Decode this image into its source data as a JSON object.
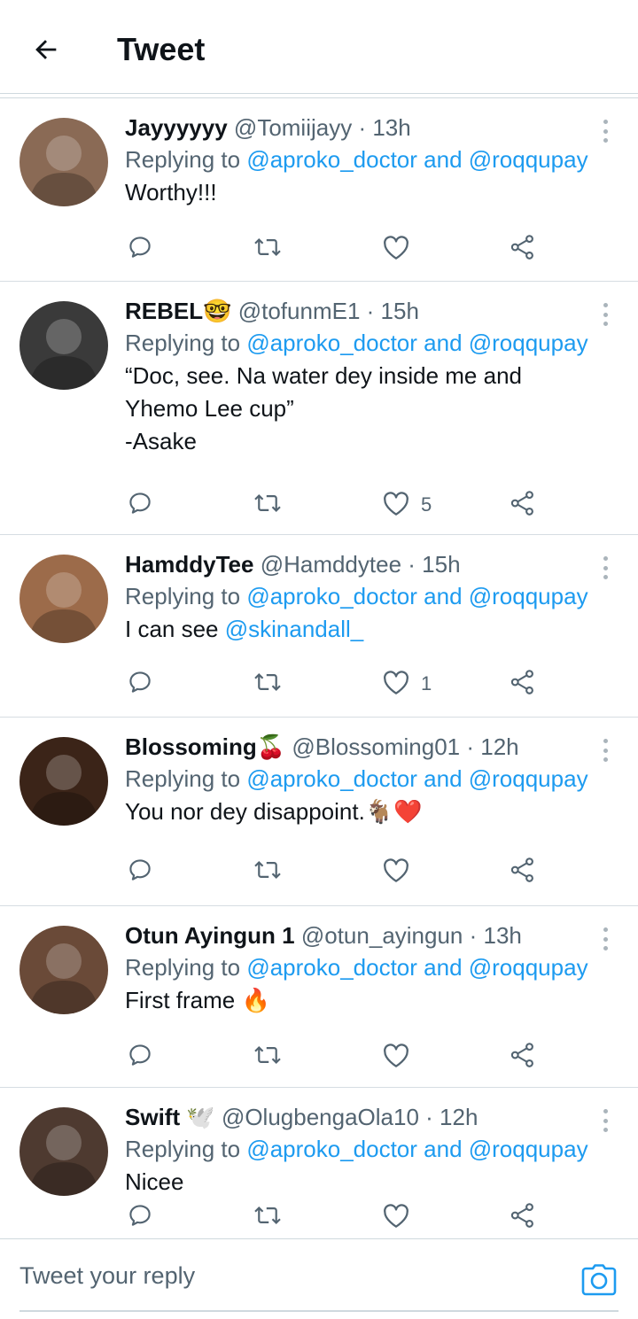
{
  "header": {
    "title": "Tweet"
  },
  "tweets": [
    {
      "name": "Jayyyyyy",
      "handle": "@Tomiijayy",
      "time": "13h",
      "replying_prefix": "Replying to",
      "replying_to": "@aproko_doctor and @roqqupay",
      "lines": [
        "Worthy!!!"
      ],
      "like_count": "",
      "avatar_bg": "#8a6a55"
    },
    {
      "name": "REBEL🤓",
      "handle": "@tofunmE1",
      "time": "15h",
      "replying_prefix": "Replying to",
      "replying_to": "@aproko_doctor and @roqqupay",
      "lines": [
        "“Doc, see. Na water dey inside me and",
        "Yhemo Lee cup”",
        "-Asake"
      ],
      "like_count": "5",
      "avatar_bg": "#3a3a3a"
    },
    {
      "name": "HamddyTee",
      "handle": "@Hamddytee",
      "time": "15h",
      "replying_prefix": "Replying to",
      "replying_to": "@aproko_doctor and @roqqupay",
      "lines": [
        "I can see"
      ],
      "mention": "@skinandall_",
      "like_count": "1",
      "avatar_bg": "#9c6b4a"
    },
    {
      "name": "Blossoming🍒",
      "handle": "@Blossoming01",
      "time": "12h",
      "replying_prefix": "Replying to",
      "replying_to": "@aproko_doctor and @roqqupay",
      "lines": [
        "You nor dey disappoint.🐐❤️"
      ],
      "like_count": "",
      "avatar_bg": "#3b2418"
    },
    {
      "name": "Otun Ayingun 1",
      "handle": "@otun_ayingun",
      "time": "13h",
      "replying_prefix": "Replying to",
      "replying_to": "@aproko_doctor and @roqqupay",
      "lines": [
        "First frame 🔥"
      ],
      "like_count": "",
      "avatar_bg": "#6a4a38"
    },
    {
      "name": "Swift 🕊️",
      "handle": "@OlugbengaOla10",
      "time": "12h",
      "replying_prefix": "Replying to",
      "replying_to": "@aproko_doctor and @roqqupay",
      "lines": [
        "Nicee"
      ],
      "like_count": "",
      "avatar_bg": "#4e3a30"
    }
  ],
  "reply_bar": {
    "placeholder": "Tweet your reply"
  },
  "icons": {
    "back": "arrow-left-icon",
    "reply": "reply-icon",
    "retweet": "retweet-icon",
    "like": "heart-icon",
    "share": "share-icon",
    "more": "more-vertical-icon",
    "camera": "camera-icon"
  },
  "colors": {
    "link": "#1d9bf0",
    "secondary": "#536471",
    "text": "#0f1419"
  }
}
